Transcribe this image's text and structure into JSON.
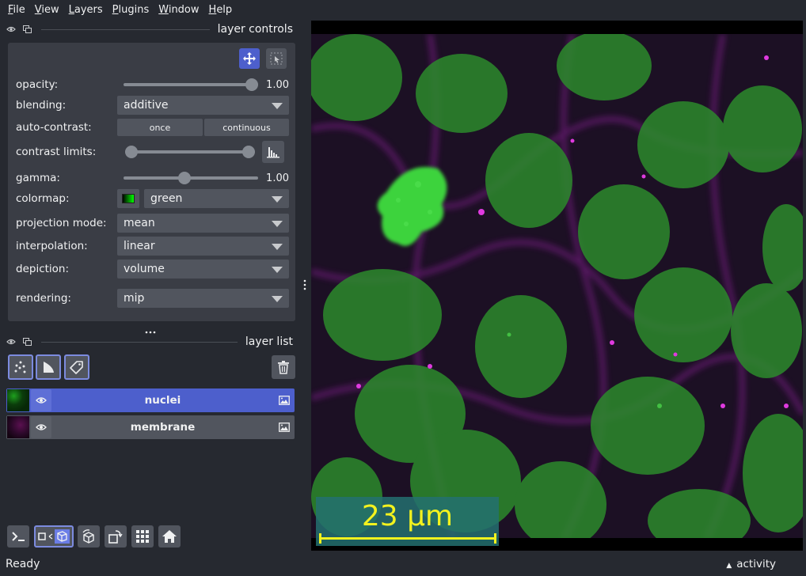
{
  "menu": [
    {
      "underline": "F",
      "rest": "ile"
    },
    {
      "underline": "V",
      "rest": "iew"
    },
    {
      "underline": "L",
      "rest": "ayers"
    },
    {
      "underline": "P",
      "rest": "lugins"
    },
    {
      "underline": "W",
      "rest": "indow"
    },
    {
      "underline": "H",
      "rest": "elp"
    }
  ],
  "layer_controls": {
    "title": "layer controls",
    "opacity_label": "opacity:",
    "opacity_value": "1.00",
    "opacity_level": 1.0,
    "blending_label": "blending:",
    "blending_value": "additive",
    "auto_contrast_label": "auto-contrast:",
    "once_label": "once",
    "continuous_label": "continuous",
    "contrast_label": "contrast limits:",
    "contrast_range": [
      0.0,
      1.0
    ],
    "gamma_label": "gamma:",
    "gamma_value": "1.00",
    "gamma_level": 0.45,
    "colormap_label": "colormap:",
    "colormap_value": "green",
    "projection_label": "projection mode:",
    "projection_value": "mean",
    "interpolation_label": "interpolation:",
    "interpolation_value": "linear",
    "depiction_label": "depiction:",
    "depiction_value": "volume",
    "rendering_label": "rendering:",
    "rendering_value": "mip"
  },
  "layer_list": {
    "title": "layer list",
    "layers": [
      {
        "name": "nuclei",
        "active": true
      },
      {
        "name": "membrane",
        "active": false
      }
    ]
  },
  "canvas": {
    "scale_bar_text": "23 µm"
  },
  "status": {
    "text": "Ready",
    "activity": "activity"
  },
  "colors": {
    "accent": "#4d5fcc",
    "background": "#262930",
    "panel": "#3a3d45",
    "scalebar": "#f3f21e"
  }
}
